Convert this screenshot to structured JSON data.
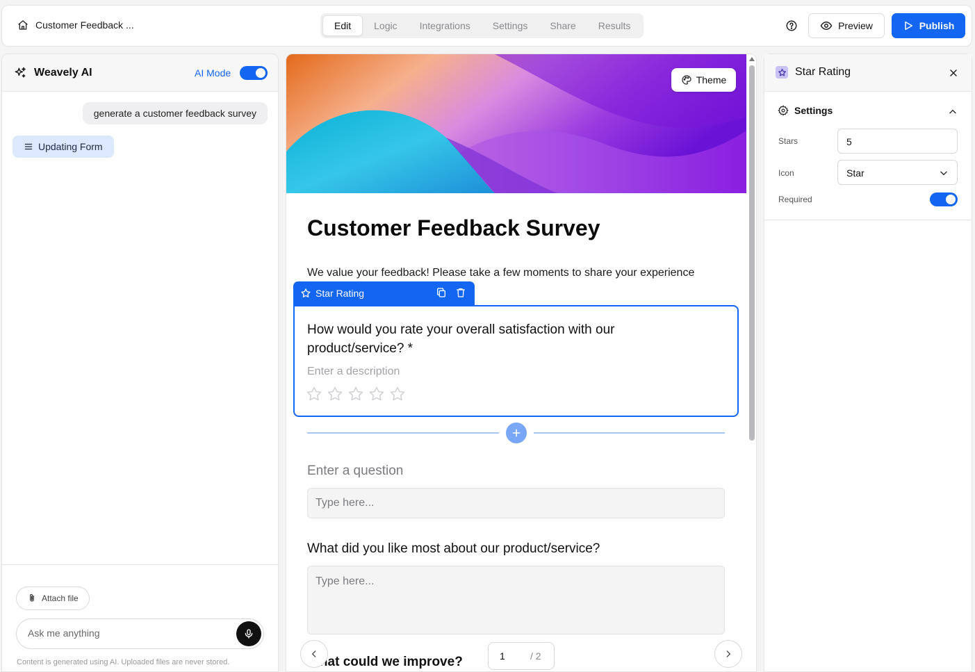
{
  "header": {
    "form_name": "Customer Feedback ...",
    "tabs": [
      {
        "label": "Edit",
        "active": true
      },
      {
        "label": "Logic",
        "active": false
      },
      {
        "label": "Integrations",
        "active": false
      },
      {
        "label": "Settings",
        "active": false
      },
      {
        "label": "Share",
        "active": false
      },
      {
        "label": "Results",
        "active": false
      }
    ],
    "preview_label": "Preview",
    "publish_label": "Publish"
  },
  "ai_panel": {
    "title": "Weavely AI",
    "mode_label": "AI Mode",
    "mode_on": true,
    "messages": {
      "user": "generate a customer feedback survey",
      "status": "Updating Form"
    },
    "attach_label": "Attach file",
    "input_placeholder": "Ask me anything",
    "disclaimer": "Content is generated using AI. Uploaded files are never stored."
  },
  "canvas": {
    "theme_label": "Theme",
    "form_title": "Customer Feedback Survey",
    "form_description": "We value your feedback! Please take a few moments to share your experience",
    "selected_block": {
      "type_label": "Star Rating",
      "question": "How would you rate your overall satisfaction with our product/service? *",
      "description_placeholder": "Enter a description",
      "star_count": 5
    },
    "new_question_placeholder": "Enter a question",
    "answer_placeholder_1": "Type here...",
    "question_2": "What did you like most about our product/service?",
    "answer_placeholder_2": "Type here...",
    "question_3_partial": "What could we improve?",
    "pager": {
      "current": "1",
      "total": "/ 2"
    }
  },
  "properties": {
    "title": "Star Rating",
    "section": "Settings",
    "stars_label": "Stars",
    "stars_value": "5",
    "icon_label": "Icon",
    "icon_value": "Star",
    "required_label": "Required",
    "required_on": true
  },
  "colors": {
    "accent": "#1366f1",
    "accent_light": "#dce8fb",
    "badge_purple": "#c9c2f5"
  },
  "icons": [
    "home-icon",
    "help-icon",
    "eye-icon",
    "play-icon",
    "sparkles-icon",
    "menu-icon",
    "paperclip-icon",
    "mic-icon",
    "palette-icon",
    "star-icon",
    "copy-icon",
    "trash-icon",
    "plus-icon",
    "chevron-left-icon",
    "chevron-right-icon",
    "close-icon",
    "gear-icon",
    "chevron-up-icon",
    "chevron-down-icon"
  ]
}
